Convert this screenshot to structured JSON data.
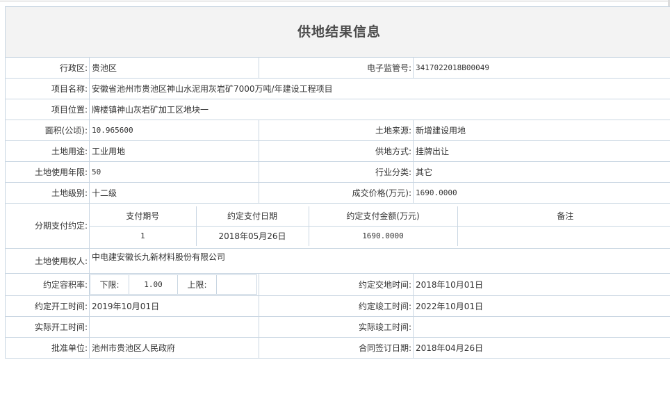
{
  "title": "供地结果信息",
  "rows": {
    "district": {
      "label": "行政区:",
      "value": "贵池区"
    },
    "ecode": {
      "label": "电子监管号:",
      "value": "3417022018B00049"
    },
    "project_name": {
      "label": "项目名称:",
      "value": "安徽省池州市贵池区神山水泥用灰岩矿7000万吨/年建设工程项目"
    },
    "project_location": {
      "label": "项目位置:",
      "value": "牌楼镇神山灰岩矿加工区地块一"
    },
    "area": {
      "label": "面积(公顷):",
      "value": "10.965600"
    },
    "land_source": {
      "label": "土地来源:",
      "value": "新增建设用地"
    },
    "land_use": {
      "label": "土地用途:",
      "value": "工业用地"
    },
    "supply_method": {
      "label": "供地方式:",
      "value": "挂牌出让"
    },
    "use_years": {
      "label": "土地使用年限:",
      "value": "50"
    },
    "industry": {
      "label": "行业分类:",
      "value": "其它"
    },
    "land_level": {
      "label": "土地级别:",
      "value": "十二级"
    },
    "price": {
      "label": "成交价格(万元):",
      "value": "1690.0000"
    },
    "installments": {
      "label": "分期支付约定:",
      "headers": [
        "支付期号",
        "约定支付日期",
        "约定支付金额(万元)",
        "备注"
      ],
      "rows": [
        [
          "1",
          "2018年05月26日",
          "1690.0000",
          ""
        ]
      ]
    },
    "owner": {
      "label": "土地使用权人:",
      "value": "中电建安徽长九新材料股份有限公司"
    },
    "far": {
      "label": "约定容积率:",
      "lower_label": "下限:",
      "lower_value": "1.00",
      "upper_label": "上限:",
      "upper_value": ""
    },
    "delivery_time": {
      "label": "约定交地时间:",
      "value": "2018年10月01日"
    },
    "start_time": {
      "label": "约定开工时间:",
      "value": "2019年10月01日"
    },
    "finish_time": {
      "label": "约定竣工时间:",
      "value": "2022年10月01日"
    },
    "actual_start": {
      "label": "实际开工时间:",
      "value": ""
    },
    "actual_finish": {
      "label": "实际竣工时间:",
      "value": ""
    },
    "approver": {
      "label": "批准单位:",
      "value": "池州市贵池区人民政府"
    },
    "contract_date": {
      "label": "合同签订日期:",
      "value": "2018年04月26日"
    }
  }
}
